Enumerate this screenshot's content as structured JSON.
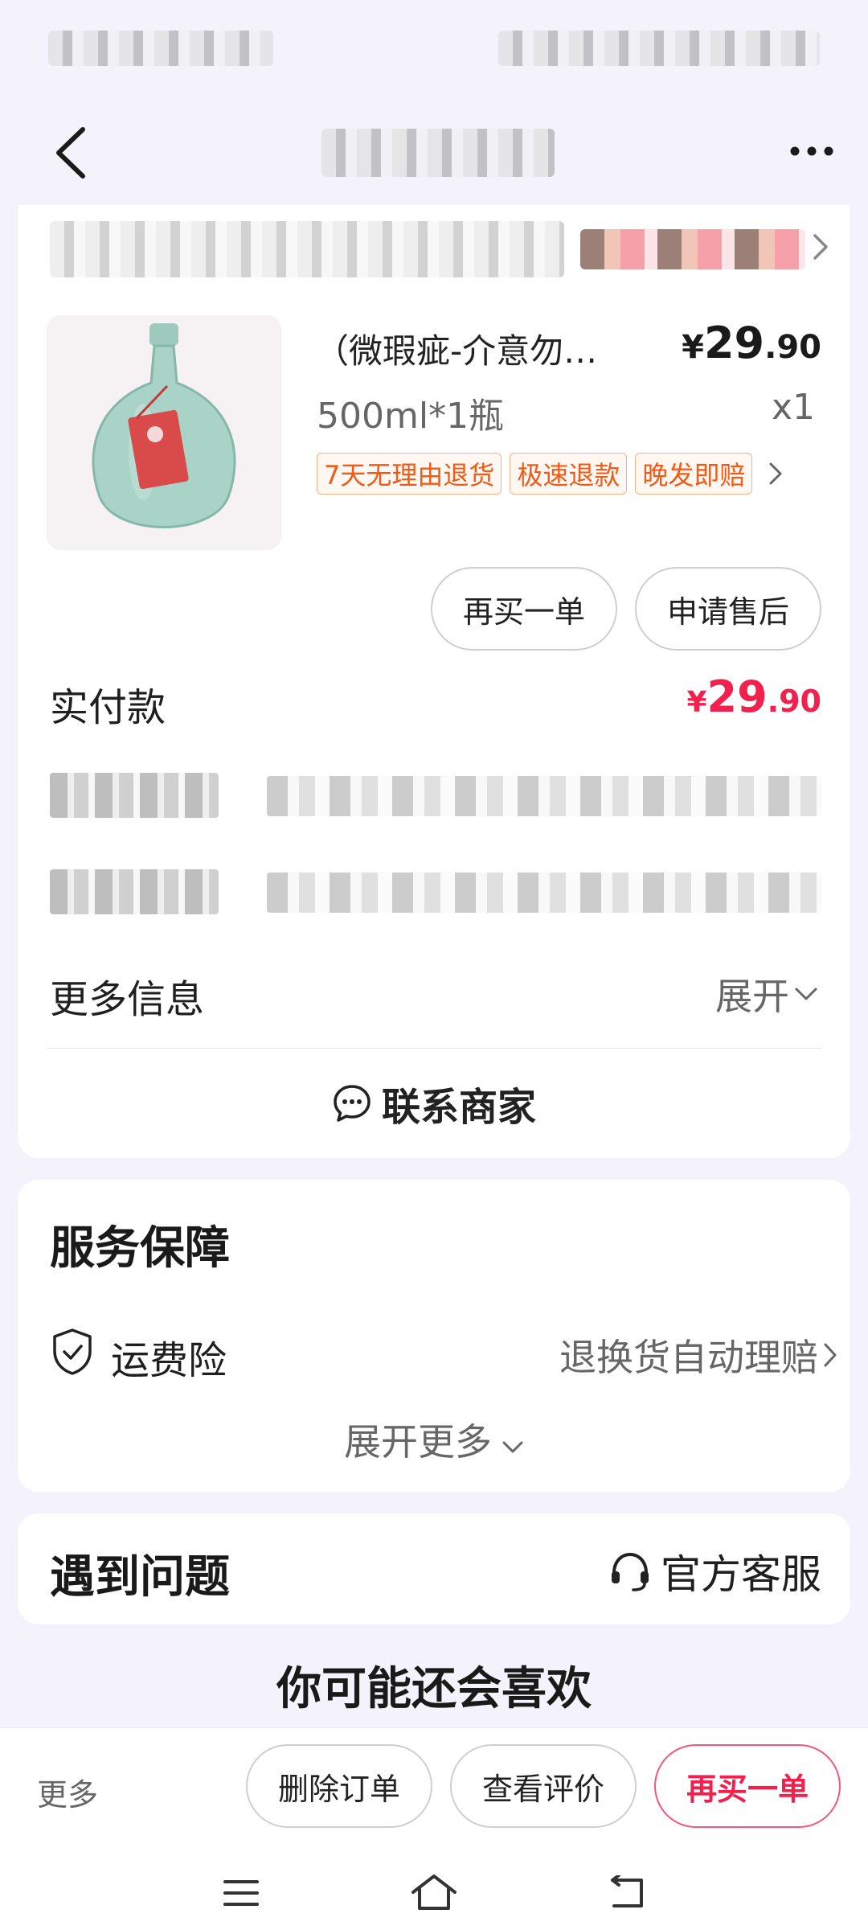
{
  "order": {
    "product_title": "（微瑕疵-介意勿…",
    "price_symbol": "¥",
    "price_int": "29",
    "price_dec": ".90",
    "spec": "500ml*1瓶",
    "qty": "x1",
    "tags": [
      "7天无理由退货",
      "极速退款",
      "晚发即赔"
    ],
    "rebuy_label": "再买一单",
    "aftersale_label": "申请售后",
    "paid_label": "实付款",
    "paid_symbol": "¥",
    "paid_int": "29",
    "paid_dec": ".90",
    "more_info_label": "更多信息",
    "expand_label": "展开",
    "contact_label": "联系商家"
  },
  "service": {
    "title": "服务保障",
    "item_name": "运费险",
    "item_value": "退换货自动理赔",
    "expand_more": "展开更多"
  },
  "help": {
    "title": "遇到问题",
    "support_label": "官方客服"
  },
  "recommend": {
    "title": "你可能还会喜欢"
  },
  "bottom_bar": {
    "more": "更多",
    "delete_label": "删除订单",
    "review_label": "查看评价",
    "rebuy_label": "再买一单"
  },
  "colors": {
    "accent": "#f0214c",
    "tag_text": "#f25a16",
    "tag_border": "#f3b48a",
    "background": "#f4f3fb"
  },
  "icons": [
    "back-icon",
    "more-dots-icon",
    "chevron-right-icon",
    "chat-icon",
    "shield-check-icon",
    "chevron-down-icon",
    "headset-icon",
    "menu-icon",
    "home-icon",
    "back-arrow-icon"
  ]
}
